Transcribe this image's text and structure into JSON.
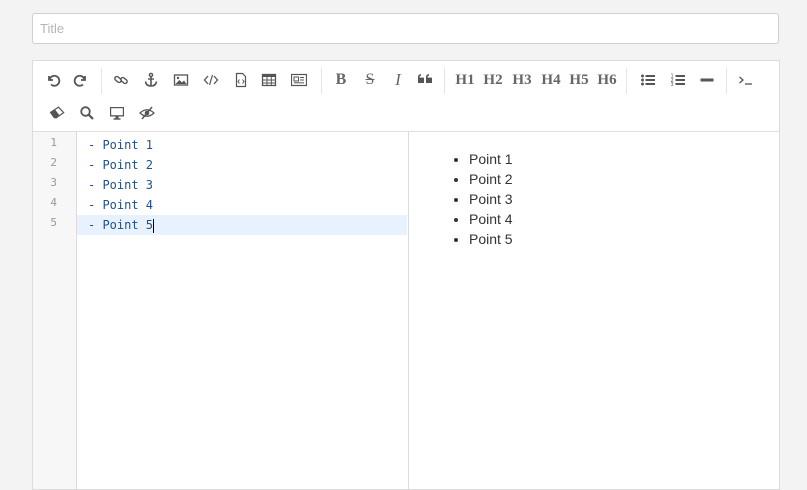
{
  "title_input": {
    "placeholder": "Title",
    "value": ""
  },
  "toolbar": {
    "row1": [
      {
        "name": "undo-icon",
        "title": "Undo"
      },
      {
        "name": "redo-icon",
        "title": "Redo"
      },
      {
        "name": "link-icon",
        "title": "Link"
      },
      {
        "name": "anchor-icon",
        "title": "Reference link"
      },
      {
        "name": "image-icon",
        "title": "Image"
      },
      {
        "name": "inline-code-icon",
        "title": "Code inline"
      },
      {
        "name": "code-block-icon",
        "title": "Preformatted text"
      },
      {
        "name": "table-icon",
        "title": "Table"
      },
      {
        "name": "html-entities-icon",
        "title": "HTML Entities"
      },
      {
        "name": "bold-icon",
        "title": "Bold",
        "text": "B"
      },
      {
        "name": "strikethrough-icon",
        "title": "Strikethrough",
        "text": "S"
      },
      {
        "name": "italic-icon",
        "title": "Italic",
        "text": "I"
      },
      {
        "name": "quote-icon",
        "title": "Block quote"
      },
      {
        "name": "h1-button",
        "text": "H1"
      },
      {
        "name": "h2-button",
        "text": "H2"
      },
      {
        "name": "h3-button",
        "text": "H3"
      },
      {
        "name": "h4-button",
        "text": "H4"
      },
      {
        "name": "h5-button",
        "text": "H5"
      },
      {
        "name": "h6-button",
        "text": "H6"
      },
      {
        "name": "unordered-list-icon",
        "title": "Unordered list"
      },
      {
        "name": "ordered-list-icon",
        "title": "Ordered list"
      },
      {
        "name": "horizontal-rule-icon",
        "title": "Horizontal rule"
      },
      {
        "name": "terminal-icon",
        "title": "Code block"
      }
    ],
    "row2": [
      {
        "name": "eraser-icon",
        "title": "Clear"
      },
      {
        "name": "search-icon",
        "title": "Search"
      },
      {
        "name": "desktop-icon",
        "title": "Fullscreen"
      },
      {
        "name": "eye-slash-icon",
        "title": "Toggle preview"
      }
    ]
  },
  "editor": {
    "line_numbers": [
      "1",
      "2",
      "3",
      "4",
      "5"
    ],
    "lines": [
      "- Point 1",
      "- Point 2",
      "- Point 3",
      "- Point 4",
      "- Point 5"
    ],
    "active_line": 5
  },
  "preview": {
    "items": [
      "Point 1",
      "Point 2",
      "Point 3",
      "Point 4",
      "Point 5"
    ]
  }
}
